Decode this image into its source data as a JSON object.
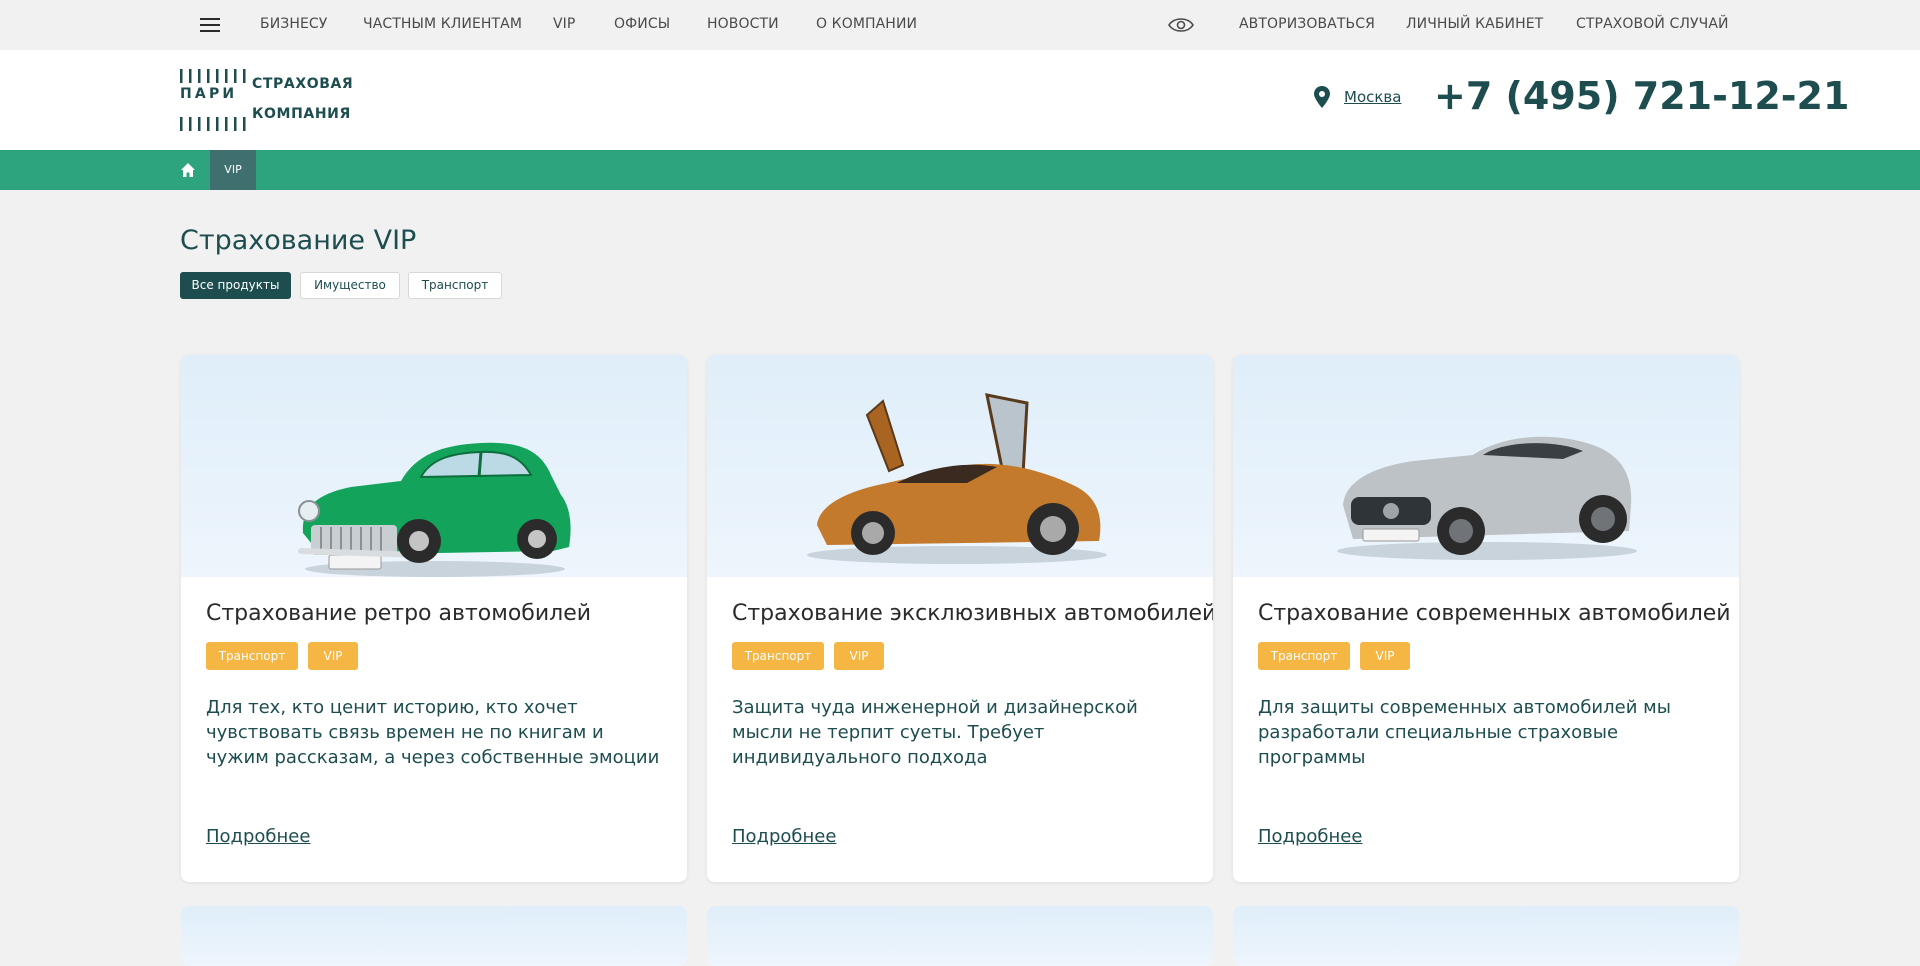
{
  "topnav": {
    "menu_icon": "hamburger-icon",
    "links": [
      "БИЗНЕСУ",
      "ЧАСТНЫМ КЛИЕНТАМ",
      "VIP",
      "ОФИСЫ",
      "НОВОСТИ",
      "О КОМПАНИИ"
    ],
    "accessibility_icon": "eye-icon",
    "right_links": [
      "АВТОРИЗОВАТЬСЯ",
      "ЛИЧНЫЙ КАБИНЕТ",
      "СТРАХОВОЙ СЛУЧАЙ"
    ]
  },
  "header": {
    "logo_word": "ПАРИ",
    "logo_line1": "СТРАХОВАЯ",
    "logo_line2": "КОМПАНИЯ",
    "city": "Москва",
    "phone": "+7 (495) 721-12-21"
  },
  "breadcrumbs": {
    "home_icon": "home-icon",
    "current": "VIP"
  },
  "page": {
    "title": "Страхование VIP",
    "filters": [
      "Все продукты",
      "Имущество",
      "Транспорт"
    ],
    "active_filter": "Все продукты"
  },
  "cards": [
    {
      "title": "Страхование ретро автомобилей",
      "tags": [
        "Транспорт",
        "VIP"
      ],
      "description": "Для  тех, кто ценит историю, кто хочет чувствовать связь времен не по книгам и чужим рассказам, а через собственные эмоции",
      "link": "Подробнее",
      "image": "green-retro-car"
    },
    {
      "title": "Страхование эксклюзивных автомобилей",
      "tags": [
        "Транспорт",
        "VIP"
      ],
      "description": "Защита чуда инженерной и дизайнерской мысли не терпит суеты. Требует индивидуального подхода",
      "link": "Подробнее",
      "image": "orange-supercar"
    },
    {
      "title": "Страхование современных автомобилей",
      "tags": [
        "Транспорт",
        "VIP"
      ],
      "description": "Для защиты современных автомобилей мы разработали специальные страховые программы",
      "link": "Подробнее",
      "image": "silver-convertible"
    }
  ],
  "colors": {
    "brand_dark": "#1d4d4f",
    "brand_green": "#2ea47e",
    "crumb_active": "#3f6f6f",
    "tag": "#f6b643",
    "background": "#f1f1f1"
  }
}
